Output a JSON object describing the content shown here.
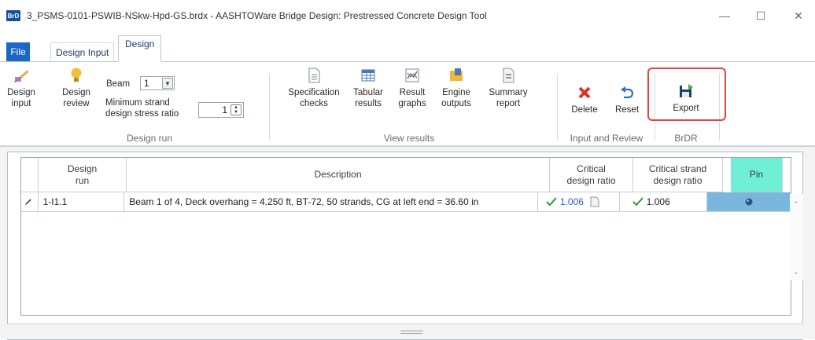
{
  "window": {
    "app_icon": "BrD",
    "title": "3_PSMS-0101-PSWIB-NSkw-Hpd-GS.brdx - AASHTOWare Bridge Design: Prestressed Concrete Design Tool",
    "minimize": "—",
    "maximize": "☐",
    "close": "✕"
  },
  "tabs": {
    "file": "File",
    "design_input": "Design Input",
    "design": "Design"
  },
  "ribbon": {
    "design_run": {
      "group_label": "Design run",
      "design_input": "Design\ninput",
      "design_review": "Design\nreview",
      "beam_label": "Beam",
      "beam_value": "1",
      "min_strand_label": "Minimum strand\ndesign stress ratio",
      "min_strand_value": "1"
    },
    "view_results": {
      "group_label": "View results",
      "specification_checks": "Specification\nchecks",
      "tabular_results": "Tabular\nresults",
      "result_graphs": "Result\ngraphs",
      "engine_outputs": "Engine\noutputs",
      "summary_report": "Summary\nreport"
    },
    "input_review": {
      "group_label": "Input and Review",
      "delete": "Delete",
      "reset": "Reset"
    },
    "brdr": {
      "group_label": "BrDR",
      "export": "Export"
    }
  },
  "grid": {
    "headers": {
      "design_run": "Design\nrun",
      "description": "Description",
      "critical_design_ratio": "Critical\ndesign ratio",
      "critical_strand_ratio": "Critical strand\ndesign ratio",
      "pin": "Pin"
    },
    "rows": [
      {
        "run": "1-I1.1",
        "description": "Beam 1 of 4, Deck overhang = 4.250 ft, BT-72, 50 strands, CG at left end = 36.60 in",
        "critical_design_ratio": "1.006",
        "critical_strand_ratio": "1.006"
      }
    ]
  },
  "colors": {
    "accent": "#1b67c6",
    "pin_header": "#6ff0d6",
    "pin_cell": "#7bb7dc",
    "highlight": "#e0463d",
    "check": "#2e9a3e"
  }
}
